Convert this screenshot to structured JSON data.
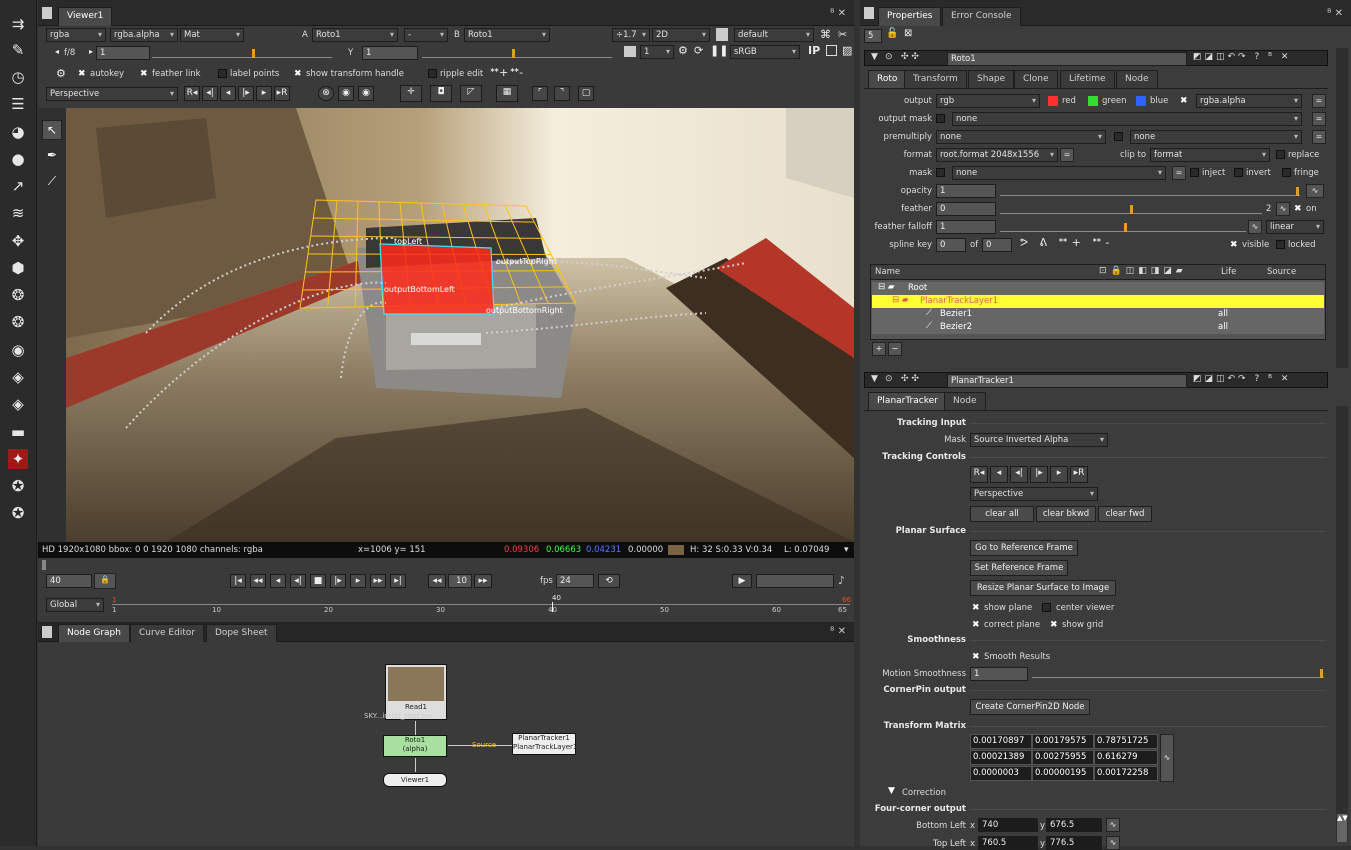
{
  "viewer": {
    "tab": "Viewer1",
    "channel_rgba": "rgba",
    "channel_alpha": "rgba.alpha",
    "channel_mat": "Mat",
    "a_label": "A",
    "a_input": "Roto1",
    "op": "-",
    "b_label": "B",
    "b_input": "Roto1",
    "gain": "÷1.7",
    "mode2d": "2D",
    "lut": "default",
    "fstop_label": "f/8",
    "fstop_value": "1",
    "gamma_label": "Y",
    "gamma_value": "1",
    "frame_select": "1",
    "colorspace": "sRGB",
    "ip_label": "IP",
    "autokey": "autokey",
    "feather_link": "feather link",
    "label_points": "label points",
    "show_transform_handle": "show transform handle",
    "ripple_edit": "ripple edit",
    "projection": "Perspective",
    "overlay_labels": [
      "topLeft",
      "outputTopRight",
      "outputBottomLeft",
      "outputBottomRight"
    ],
    "info_format": "HD 1920x1080 bbox: 0 0 1920 1080 channels: rgba",
    "info_xy": "x=1006 y= 151",
    "info_r": "0.09306",
    "info_g": "0.06663",
    "info_b": "0.04231",
    "info_a": "0.00000",
    "info_hsv": "H: 32 S:0.33 V:0.34",
    "info_l": "L: 0.07049"
  },
  "timeline": {
    "frame": "40",
    "step": "10",
    "fps_label": "fps",
    "fps": "24",
    "range": "Global",
    "ticks": [
      "1",
      "10",
      "20",
      "30",
      "40",
      "50",
      "60",
      "65"
    ],
    "start": "1",
    "current": "40",
    "end": "66"
  },
  "nodegraph": {
    "tabs": [
      "Node Graph",
      "Curve Editor",
      "Dope Sheet"
    ],
    "read_label": "Read1",
    "read_file": "SKY...intrst_shot.exr",
    "roto_label": "Roto1",
    "roto_sub": "(alpha)",
    "viewer_label": "Viewer1",
    "pt_label": "PlanarTracker1",
    "pt_sub": "PlanarTrackLayer1",
    "edge_label": "Source"
  },
  "props": {
    "tabs": [
      "Properties",
      "Error Console"
    ],
    "max_panels": "5",
    "roto_name": "Roto1",
    "roto_tabs": [
      "Roto",
      "Transform",
      "Shape",
      "Clone",
      "Lifetime",
      "Node"
    ],
    "output_label": "output",
    "output": "rgb",
    "red": "red",
    "green": "green",
    "blue": "blue",
    "out_alpha": "rgba.alpha",
    "output_mask_label": "output mask",
    "output_mask": "none",
    "premult_label": "premultiply",
    "premult": "none",
    "premult2": "none",
    "format_label": "format",
    "format": "root.format 2048x1556",
    "clip_label": "clip to",
    "clip": "format",
    "replace": "replace",
    "mask_label": "mask",
    "mask": "none",
    "inject": "inject",
    "invert": "invert",
    "fringe": "fringe",
    "opacity_label": "opacity",
    "opacity": "1",
    "feather_label": "feather",
    "feather": "0",
    "feather_count": "2",
    "on": "on",
    "falloff_label": "feather falloff",
    "falloff": "1",
    "falloff_mode": "linear",
    "spline_label": "spline key",
    "spline_key": "0",
    "of": "of",
    "spline_total": "0",
    "visible": "visible",
    "locked": "locked",
    "opacity_ticks": [
      "0",
      "0.01",
      "0.05",
      "0.1",
      "0.2",
      "0.3",
      "0.4",
      "0.5",
      "0.6",
      "0.7",
      "0.8",
      "0.9",
      "1"
    ],
    "feather_ticks": [
      "-100",
      "-75",
      "-40",
      "-10",
      "0",
      "10",
      "40",
      "75",
      "100"
    ],
    "falloff_ticks": [
      "0",
      "0.2",
      "0.3",
      "0.4",
      "0.5",
      "0.7",
      "1",
      "2",
      "3",
      "4",
      "5"
    ],
    "tree_headers": [
      "Name",
      "Life",
      "Source"
    ],
    "tree": [
      {
        "name": "Root"
      },
      {
        "name": "PlanarTrackLayer1"
      },
      {
        "name": "Bezier1",
        "life": "all"
      },
      {
        "name": "Bezier2",
        "life": "all"
      }
    ],
    "pt_name": "PlanarTracker1",
    "pt_tabs": [
      "PlanarTracker",
      "Node"
    ],
    "tracking_input": "Tracking Input",
    "mask_label2": "Mask",
    "mask_src": "Source Inverted Alpha",
    "tracking_controls": "Tracking Controls",
    "pt_projection": "Perspective",
    "clear_all": "clear all",
    "clear_bkwd": "clear bkwd",
    "clear_fwd": "clear fwd",
    "planar_surface": "Planar Surface",
    "goto_ref": "Go to Reference Frame",
    "set_ref": "Set Reference Frame",
    "resize": "Resize Planar Surface to Image",
    "show_plane": "show plane",
    "center_viewer": "center viewer",
    "correct_plane": "correct plane",
    "show_grid": "show grid",
    "smoothness": "Smoothness",
    "smooth_results": "Smooth Results",
    "motion_smoothness_label": "Motion Smoothness",
    "motion_smoothness": "1",
    "motion_ticks": [
      "0",
      "0.01",
      "0.05",
      "0.1",
      "0.2",
      "0.3",
      "0.4",
      "0.5",
      "0.6",
      "0.7",
      "0.8",
      "0.9",
      "1"
    ],
    "cornerpin_output": "CornerPin output",
    "create_cp": "Create CornerPin2D Node",
    "transform_matrix": "Transform Matrix",
    "matrix": [
      [
        "0.00170897",
        "0.00179575",
        "0.78751725"
      ],
      [
        "0.00021389",
        "0.00275955",
        "0.616279"
      ],
      [
        "0.0000003",
        "0.00000195",
        "0.00172258"
      ]
    ],
    "correction": "Correction",
    "four_corner": "Four-corner output",
    "bl_label": "Bottom Left",
    "bl_x": "740",
    "bl_y": "676.5",
    "tl_label": "Top Left",
    "tl_x": "760.5",
    "tl_y": "776.5",
    "x": "x",
    "y": "y"
  },
  "icons": [
    "toolbar",
    "pen",
    "clock",
    "menu",
    "color-wheel",
    "circle",
    "channel",
    "layers",
    "transform",
    "hexagon",
    "filter",
    "keyer",
    "merge",
    "tag",
    "tag2",
    "drawer",
    "particles",
    "3d",
    "help",
    "plugin"
  ],
  "colors": {
    "accent": "#e8a020",
    "selection_yellow": "#ffff33",
    "roto_green": "#a8e0a0",
    "track_orange": "#e0a020"
  }
}
